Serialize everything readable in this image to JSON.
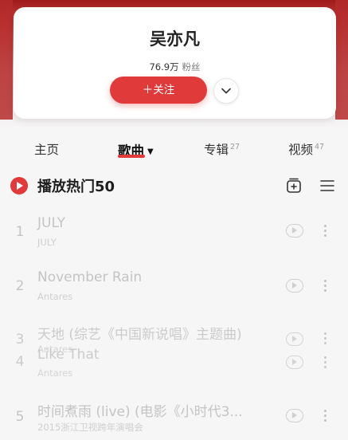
{
  "artist": {
    "name": "吴亦凡",
    "fans_count": "76.9万",
    "fans_label": "粉丝",
    "follow_label": "＋关注"
  },
  "tabs": {
    "home": "主页",
    "songs": "歌曲",
    "albums": "专辑",
    "albums_count": "27",
    "videos": "视频",
    "videos_count": "47"
  },
  "section": {
    "title": "播放热门50"
  },
  "songs": [
    {
      "index": "1",
      "title": "JULY",
      "artist": "JULY"
    },
    {
      "index": "2",
      "title": "November Rain",
      "artist": "Antares"
    },
    {
      "index": "3",
      "title": "天地 (综艺《中国新说唱》主题曲)",
      "artist": "Antares"
    },
    {
      "index": "4",
      "title": "Like That",
      "artist": "Antares"
    },
    {
      "index": "5",
      "title": "时间煮雨 (live) (电影《小时代3...",
      "artist": "2015浙江卫视跨年演唱会"
    }
  ],
  "icons": {
    "follow_more": "chevron-down-icon",
    "play_all": "play-circle-icon",
    "add_to_playlist": "add-collection-icon",
    "multi_select": "list-icon",
    "mv": "mv-play-icon",
    "more": "more-vertical-icon"
  },
  "colors": {
    "accent": "#e03a3a",
    "header_bg": "#b52b2b",
    "muted_text": "#c4c4c4"
  }
}
